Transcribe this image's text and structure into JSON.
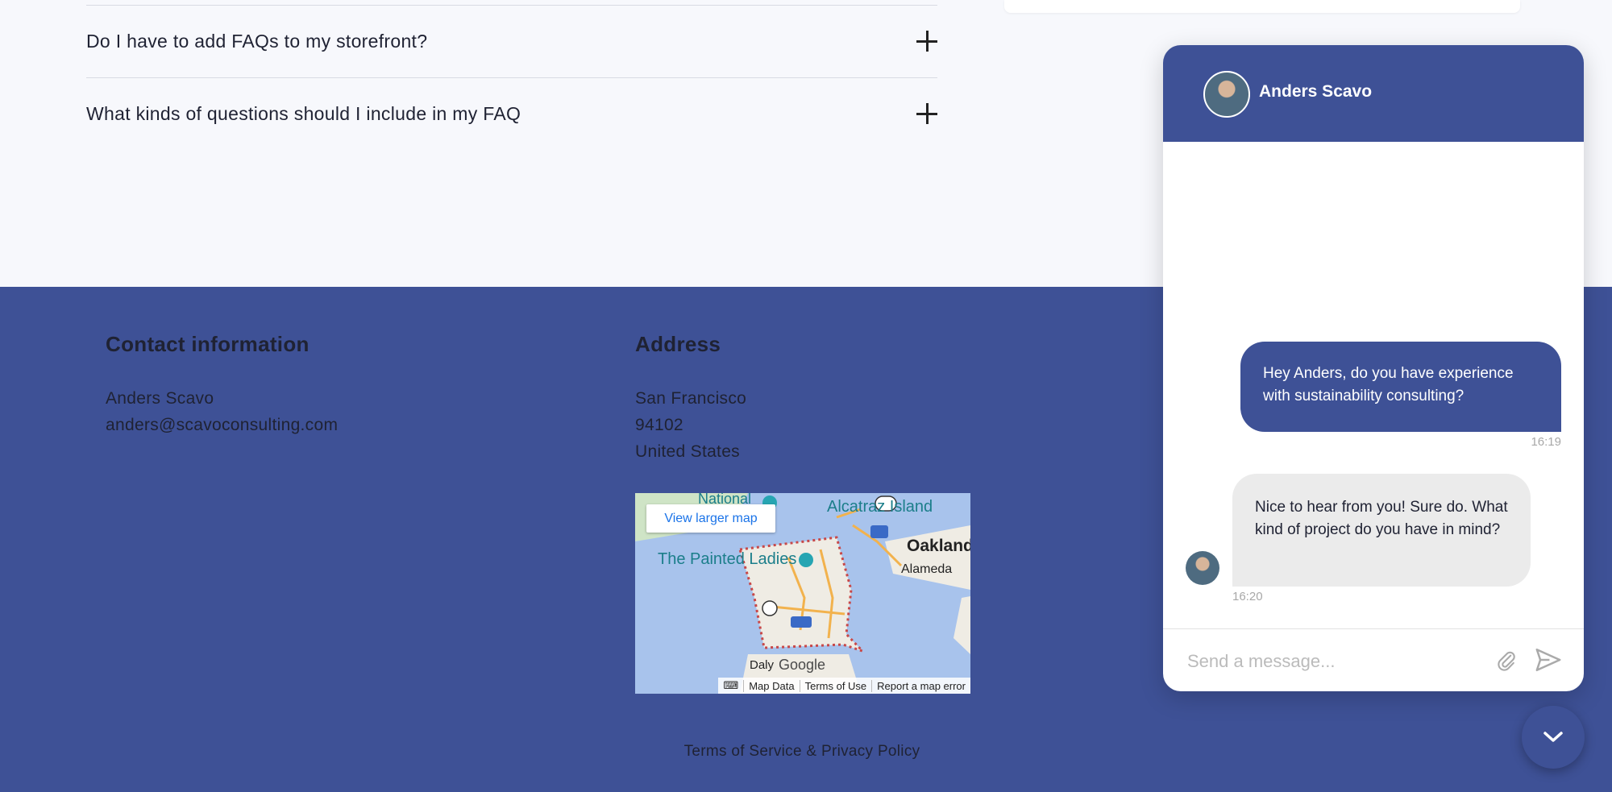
{
  "faq": {
    "items": [
      {
        "question": "Do I have to add FAQs to my storefront?"
      },
      {
        "question": "What kinds of questions should I include in my FAQ"
      }
    ]
  },
  "footer": {
    "contact": {
      "heading": "Contact information",
      "name": "Anders Scavo",
      "email": "anders@scavoconsulting.com"
    },
    "address": {
      "heading": "Address",
      "city": "San Francisco",
      "zip": "94102",
      "country": "United States"
    },
    "map": {
      "view_larger": "View larger map",
      "labels": [
        "National",
        "Alcatraz Island",
        "The Painted Ladies",
        "Oakland",
        "Alameda",
        "Daly",
        "Google"
      ],
      "footer_links": [
        "Map Data",
        "Terms of Use",
        "Report a map error"
      ]
    },
    "legal": "Terms of Service & Privacy Policy"
  },
  "chat": {
    "agent_name": "Anders Scavo",
    "messages": [
      {
        "from": "user",
        "text": "Hey Anders, do you have experience with sustainability consulting?",
        "time": "16:19"
      },
      {
        "from": "agent",
        "text": "Nice to hear from you! Sure do. What kind of project do you have in mind?",
        "time": "16:20"
      }
    ],
    "input_placeholder": "Send a message...",
    "icons": {
      "attach": "paperclip-icon",
      "send": "send-icon",
      "toggle": "chevron-down-icon"
    }
  },
  "colors": {
    "brand": "#3e5196",
    "page_bg": "#f7f8fc",
    "agent_bubble": "#ebebeb"
  }
}
